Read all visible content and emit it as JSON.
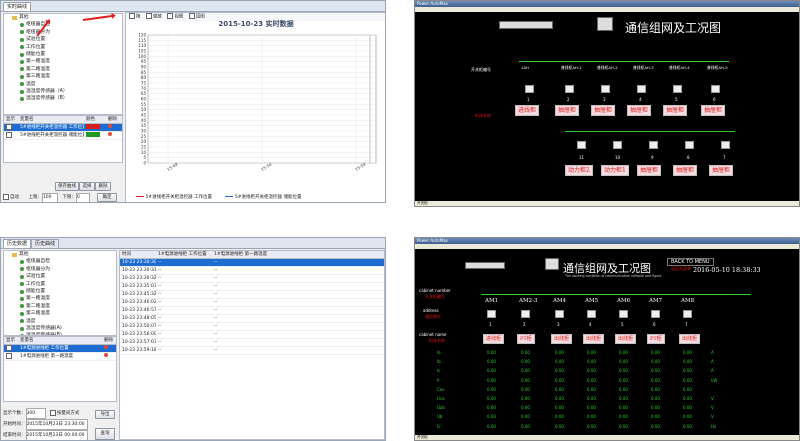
{
  "panel1": {
    "tabs": [
      "实时曲线"
    ],
    "tree_root": "其他",
    "tree_items": [
      "枢纽器自检",
      "枢纽器分为",
      "试验位置",
      "工作位置",
      "储能位置",
      "第一路温度",
      "第二路温度",
      "第三路温度",
      "温度",
      "温湿度传感器（A）",
      "温湿度传感器（B）"
    ],
    "list_headers": [
      "显示",
      "变量名",
      "颜色",
      "删除"
    ],
    "list_rows": [
      {
        "name": "5#进线柜开关柜温控器 工作位置",
        "color": "#d62020"
      },
      {
        "name": "5#进线柜开关柜温控器 储能位置",
        "color": "#1f9a1f"
      }
    ],
    "buttons": [
      "保存曲线",
      "选择",
      "删除"
    ],
    "autoscale_label": "自动",
    "upper_label": "上限：",
    "upper_value": "100",
    "lower_label": "下限：",
    "lower_value": "0",
    "apply_button": "确定",
    "toolbar": [
      "拖",
      "缩放",
      "视图",
      "回图"
    ],
    "chart_title": "2015-10-23 实时数据",
    "legend": [
      "5#进线柜开关柜温控器 工作位置",
      "5#进线柜开关柜温控器 储能位置"
    ]
  },
  "chart_data": {
    "type": "line",
    "title": "2015-10-23 实时数据",
    "ylim": [
      0,
      120
    ],
    "yticks": [
      0,
      5,
      10,
      15,
      20,
      25,
      30,
      35,
      40,
      45,
      50,
      55,
      60,
      65,
      70,
      75,
      80,
      85,
      90,
      95,
      100,
      105,
      110,
      115,
      120
    ],
    "xticks": [
      "15:49",
      "15:54",
      "15:59"
    ],
    "series": [
      {
        "name": "5#进线柜开关柜温控器 工作位置",
        "color": "#d62020",
        "values": []
      },
      {
        "name": "5#进线柜开关柜温控器 储能位置",
        "color": "#1f6cd0",
        "values": []
      }
    ]
  },
  "panel2": {
    "title": "通信组网及工况图",
    "row_label": "开关柜编号",
    "cabinets_top": [
      "1AH",
      "普线柜AH-1",
      "普线柜AH-2",
      "普线柜AH-3",
      "普线柜AH-4",
      "普线柜AH-5"
    ],
    "addr_label": "通信地址",
    "addr_top": [
      "1",
      "2",
      "3",
      "4",
      "5",
      "6"
    ],
    "name_label": "柜体名称",
    "labels_top": [
      "进线柜",
      "抽屉柜",
      "抽屉柜",
      "抽屉柜",
      "抽屉柜",
      "抽屉柜"
    ],
    "addr_bottom": [
      "11",
      "10",
      "9",
      "8",
      "7"
    ],
    "labels_bottom": [
      "动力柜2",
      "动力柜1",
      "抽屉柜",
      "抽屉柜",
      "抽屉柜"
    ],
    "status": "开关柜"
  },
  "panel3": {
    "tabs": [
      "历史数据",
      "历史曲线"
    ],
    "tree_root": "其他",
    "tree_items": [
      "枢纽器自检",
      "枢纽器分为",
      "试验位置",
      "工作位置",
      "储能位置",
      "第一路温度",
      "第二路温度",
      "第三路温度",
      "温度",
      "温湿度传感器(A)",
      "温湿度传感器(B)"
    ],
    "list_headers": [
      "显示",
      "变量名",
      "删除"
    ],
    "list_rows": [
      "1#电源进线柜 工作位置",
      "1#电源进线柜 第一路温度"
    ],
    "grid_headers": [
      "时间",
      "1#电源进线柜 工作位置",
      "1#电源进线柜 第一路温度"
    ],
    "grid_rows": [
      [
        "10-23 23:30:30",
        "--",
        "--"
      ],
      [
        "10-23 23:30:31",
        "--",
        "--"
      ],
      [
        "10-23 23:30:32",
        "--",
        "--"
      ],
      [
        "10-23 23:35:03",
        "--",
        "--"
      ],
      [
        "10-23 23:45:32",
        "--",
        "--"
      ],
      [
        "10-23 23:46:02",
        "--",
        "--"
      ],
      [
        "10-23 23:46:57",
        "--",
        "--"
      ],
      [
        "10-23 23:48:05",
        "--",
        "--"
      ],
      [
        "10-23 23:50:07",
        "--",
        "--"
      ],
      [
        "10-23 23:56:00",
        "--",
        "--"
      ],
      [
        "10-23 23:57:03",
        "--",
        "--"
      ],
      [
        "10-23 23:59:18",
        "--",
        "--"
      ]
    ],
    "count_label": "显示个数：",
    "count_value": "300",
    "mode_label": "按量间方式",
    "export": "导出",
    "start_label": "开始时间：",
    "start_value": "2015年10月23日 23:30:00",
    "end_label": "结束时间：",
    "end_value": "2015年10月23日 00:00:00",
    "query": "查询"
  },
  "panel4": {
    "title": "通信组网及工况图",
    "subtitle": "The working condition of communication network and figure",
    "back_button": "BACK TO MENU",
    "back_sub": "返回主菜单",
    "datetime": "2016-05-10 18:38:33",
    "cab_row_label": "cabinet number",
    "cab_row_sub": "开关柜编号",
    "cabinets": [
      "AM1",
      "AM2-3",
      "AM4",
      "AM5",
      "AM6",
      "AM7",
      "AM8"
    ],
    "addr_label": "address",
    "addr_sub": "通信地址",
    "addrs": [
      "1",
      "2",
      "3",
      "4",
      "5",
      "6",
      "7"
    ],
    "name_label": "cabinet name",
    "name_sub": "柜体名称",
    "labels": [
      "进线柜",
      "PT柜",
      "出线柜",
      "出线柜",
      "出线柜",
      "PT柜",
      "出线柜"
    ],
    "row_names": [
      "Ia",
      "Ib",
      "Ic",
      "P",
      "Cos",
      "Uca",
      "Uab",
      "Ub",
      "Fr"
    ],
    "row_values": [
      "0.00",
      "0.00",
      "0.00",
      "0.00",
      "0.00",
      "0.00",
      "0.00"
    ],
    "row_units": [
      "A",
      "A",
      "A",
      "kW",
      "",
      "V",
      "V",
      "V",
      "Hz"
    ],
    "status": "开关柜"
  }
}
